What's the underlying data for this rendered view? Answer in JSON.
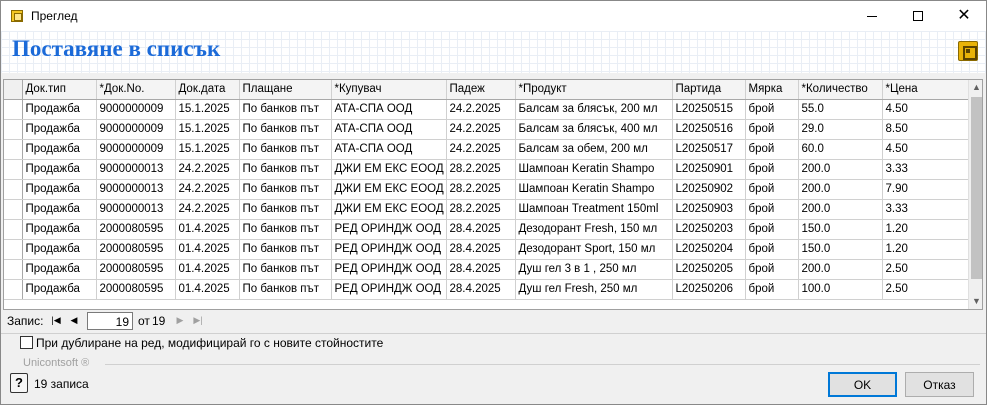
{
  "window": {
    "title": "Преглед"
  },
  "header": {
    "title": "Поставяне в списък"
  },
  "grid": {
    "columns": [
      "Док.тип",
      "*Док.No.",
      "Док.дата",
      "Плащане",
      "*Купувач",
      "Падеж",
      "*Продукт",
      "Партида",
      "Мярка",
      "*Количество",
      "*Цена"
    ],
    "rows": [
      [
        "Продажба",
        "9000000009",
        "15.1.2025",
        "По банков път",
        "АТА-СПА ООД",
        "24.2.2025",
        "Балсам за блясък, 200 мл",
        "L20250515",
        "брой",
        "55.0",
        "4.50"
      ],
      [
        "Продажба",
        "9000000009",
        "15.1.2025",
        "По банков път",
        "АТА-СПА ООД",
        "24.2.2025",
        "Балсам за блясък, 400 мл",
        "L20250516",
        "брой",
        "29.0",
        "8.50"
      ],
      [
        "Продажба",
        "9000000009",
        "15.1.2025",
        "По банков път",
        "АТА-СПА ООД",
        "24.2.2025",
        "Балсам за обем, 200 мл",
        "L20250517",
        "брой",
        "60.0",
        "4.50"
      ],
      [
        "Продажба",
        "9000000013",
        "24.2.2025",
        "По банков път",
        "ДЖИ ЕМ ЕКС ЕООД",
        "28.2.2025",
        "Шампоан Keratin Shampo",
        "L20250901",
        "брой",
        "200.0",
        "3.33"
      ],
      [
        "Продажба",
        "9000000013",
        "24.2.2025",
        "По банков път",
        "ДЖИ ЕМ ЕКС ЕООД",
        "28.2.2025",
        "Шампоан Keratin Shampo",
        "L20250902",
        "брой",
        "200.0",
        "7.90"
      ],
      [
        "Продажба",
        "9000000013",
        "24.2.2025",
        "По банков път",
        "ДЖИ ЕМ ЕКС ЕООД",
        "28.2.2025",
        "Шампоан Treatment 150ml",
        "L20250903",
        "брой",
        "200.0",
        "3.33"
      ],
      [
        "Продажба",
        "2000080595",
        "01.4.2025",
        "По банков път",
        "РЕД ОРИНДЖ ООД",
        "28.4.2025",
        "Дезодорант Fresh, 150 мл",
        "L20250203",
        "брой",
        "150.0",
        "1.20"
      ],
      [
        "Продажба",
        "2000080595",
        "01.4.2025",
        "По банков път",
        "РЕД ОРИНДЖ ООД",
        "28.4.2025",
        "Дезодорант Sport, 150 мл",
        "L20250204",
        "брой",
        "150.0",
        "1.20"
      ],
      [
        "Продажба",
        "2000080595",
        "01.4.2025",
        "По банков път",
        "РЕД ОРИНДЖ ООД",
        "28.4.2025",
        "Душ гел 3 в 1 , 250 мл",
        "L20250205",
        "брой",
        "200.0",
        "2.50"
      ],
      [
        "Продажба",
        "2000080595",
        "01.4.2025",
        "По банков път",
        "РЕД ОРИНДЖ ООД",
        "28.4.2025",
        "Душ гел Fresh, 250 мл",
        "L20250206",
        "брой",
        "100.0",
        "2.50"
      ]
    ]
  },
  "navigator": {
    "label": "Запис:",
    "current": "19",
    "of_label": "от",
    "total": "19"
  },
  "duplicate_option": {
    "label": "При дублиране на ред, модифицирай го с новите стойностите",
    "checked": false
  },
  "footer": {
    "brand": "Unicontsoft ®",
    "records_text": "19 записа",
    "ok_label": "OK",
    "cancel_label": "Отказ"
  },
  "colors": {
    "title_blue": "#1b6ad8",
    "accent_focus": "#0078d7"
  }
}
